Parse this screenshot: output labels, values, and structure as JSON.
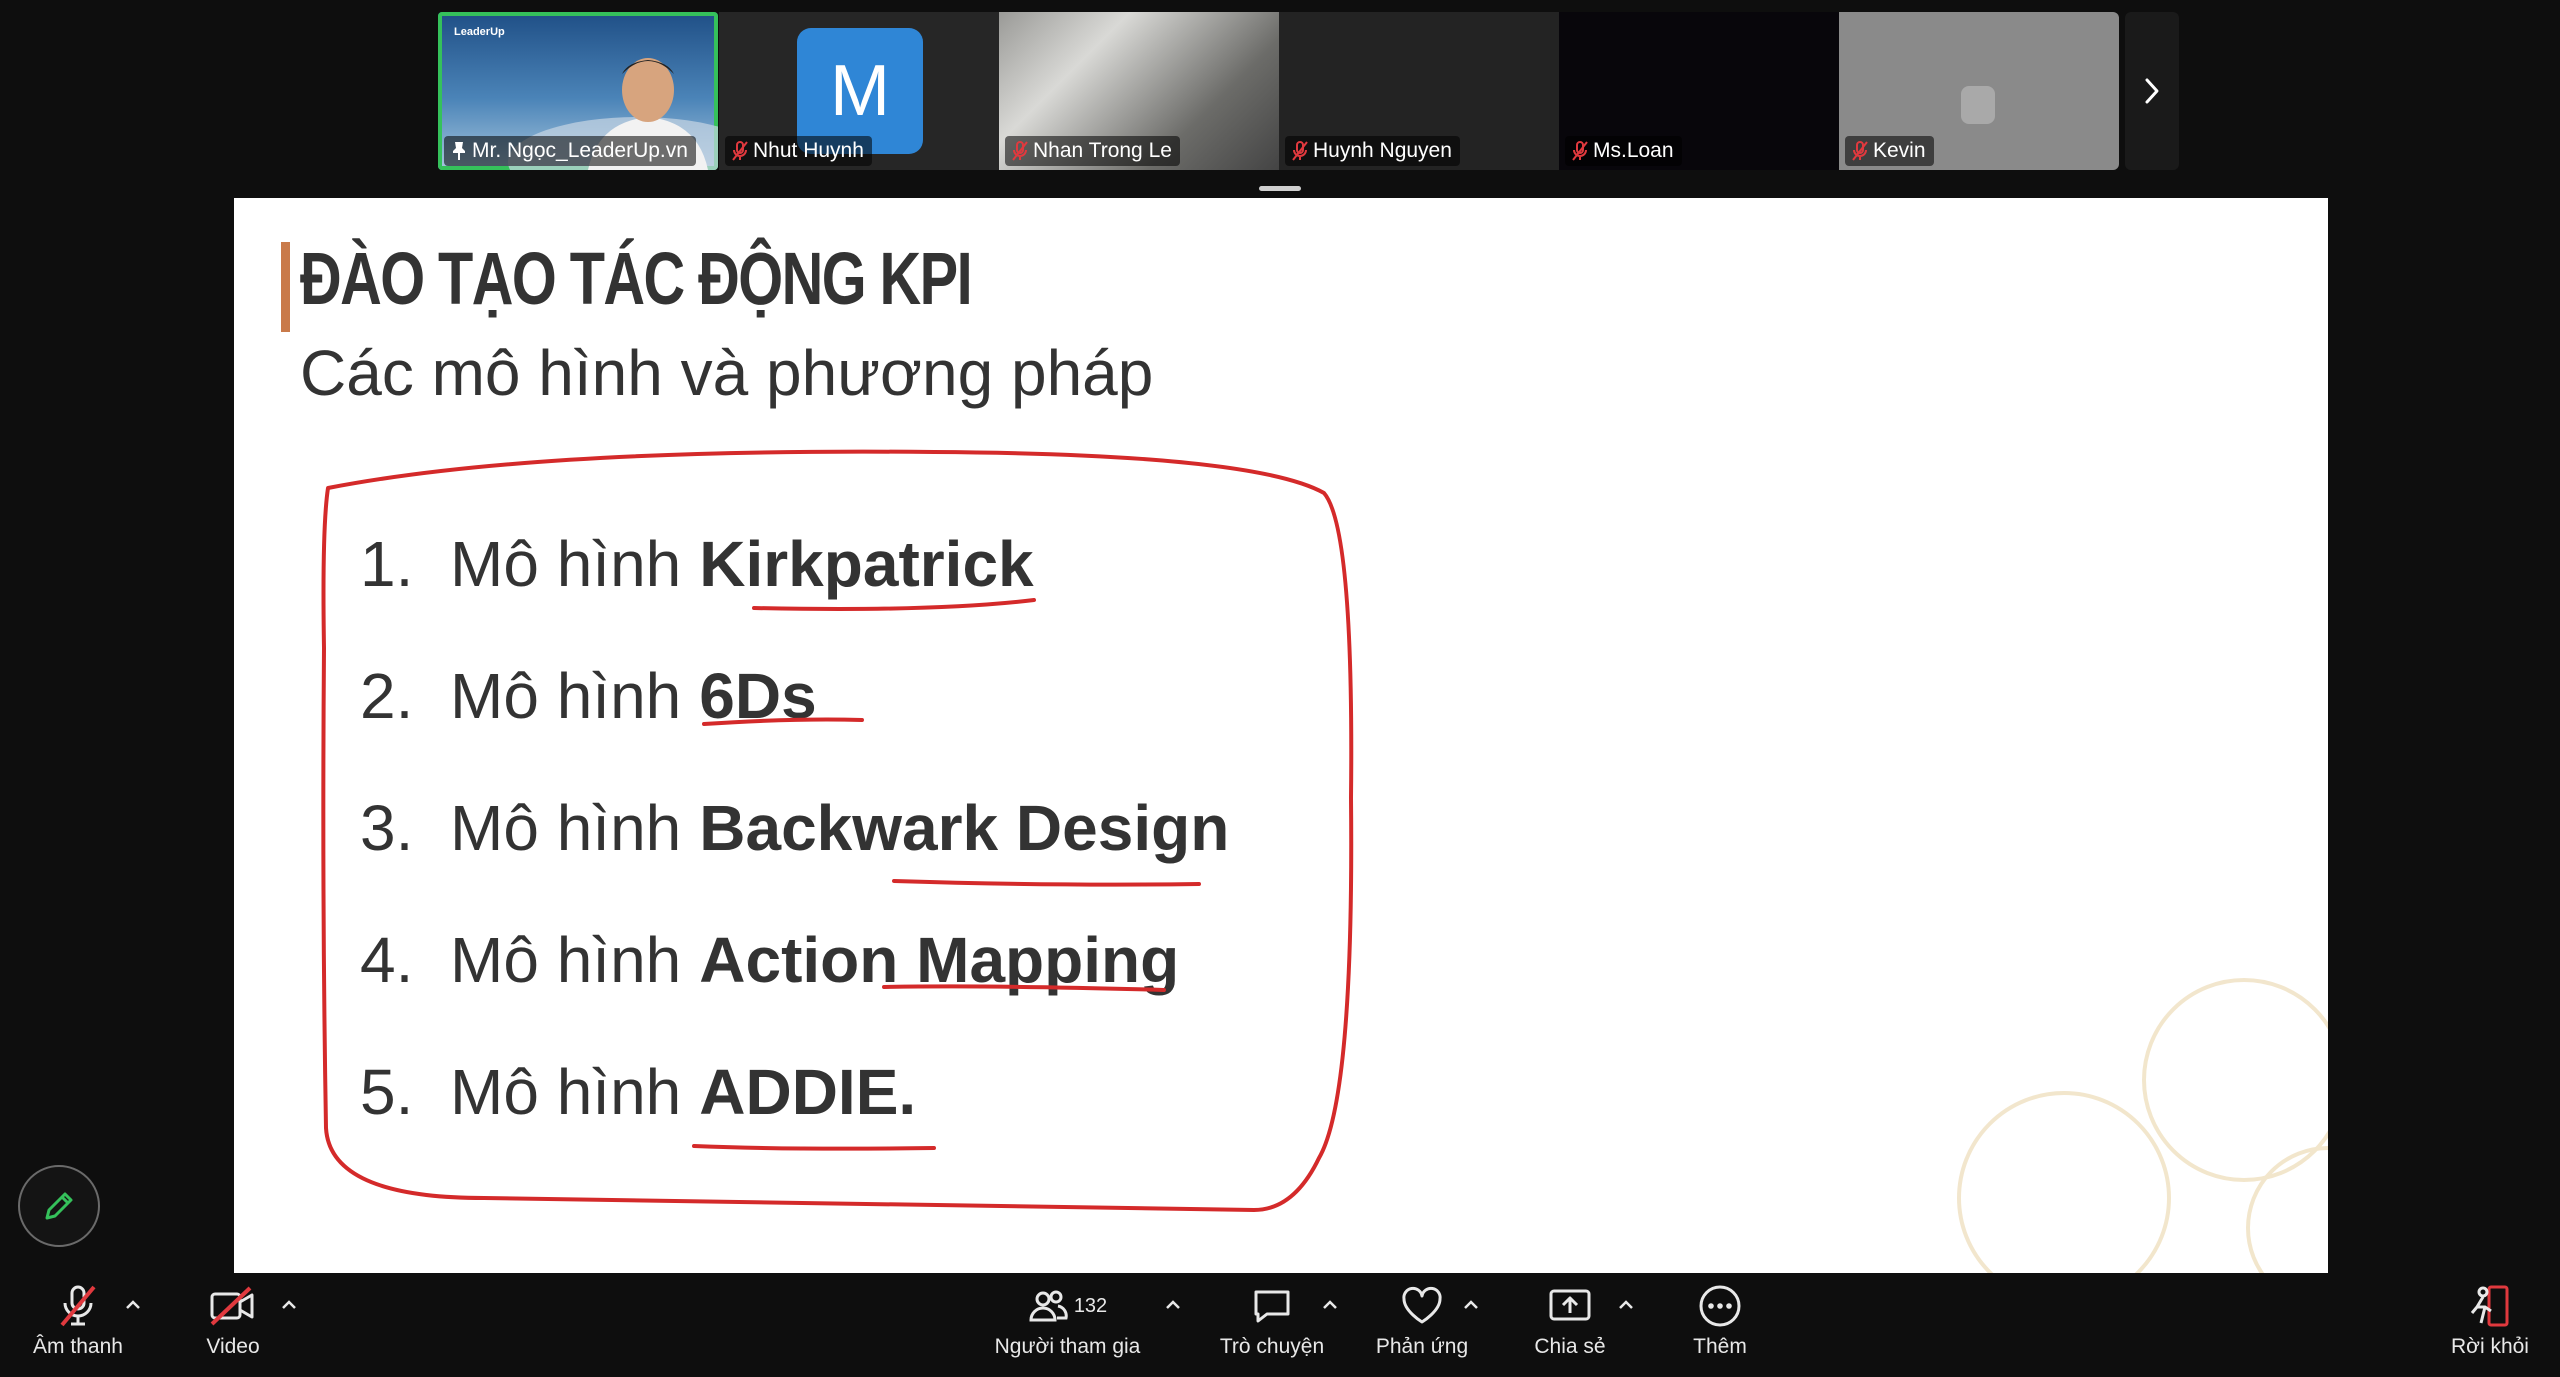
{
  "participants": [
    {
      "name": "Mr. Ngọc_LeaderUp.vn",
      "status": "pinned",
      "video": true,
      "logo_text": "LeaderUp"
    },
    {
      "name": "Nhut Huynh",
      "status": "muted",
      "avatar_letter": "M"
    },
    {
      "name": "Nhan Trong Le",
      "status": "muted"
    },
    {
      "name": "Huynh Nguyen",
      "status": "muted"
    },
    {
      "name": "Ms.Loan",
      "status": "muted"
    },
    {
      "name": "Kevin",
      "status": "muted"
    }
  ],
  "slide": {
    "title": "ĐÀO TẠO TÁC ĐỘNG KPI",
    "subtitle": "Các mô hình và phương pháp",
    "items": [
      {
        "num": "1.",
        "prefix": "Mô hình",
        "bold": "Kirkpatrick"
      },
      {
        "num": "2.",
        "prefix": "Mô hình",
        "bold": "6Ds"
      },
      {
        "num": "3.",
        "prefix": "Mô hình",
        "bold": "Backwark Design"
      },
      {
        "num": "4.",
        "prefix": "Mô hình",
        "bold": "Action Mapping"
      },
      {
        "num": "5.",
        "prefix": "Mô hình",
        "bold": "ADDIE."
      }
    ],
    "accent_color": "#c97a4a",
    "ink_color": "#d42a2a"
  },
  "toolbar": {
    "audio_label": "Âm thanh",
    "video_label": "Video",
    "participants_label": "Người tham gia",
    "participants_count": "132",
    "chat_label": "Trò chuyện",
    "reactions_label": "Phản ứng",
    "share_label": "Chia sẻ",
    "more_label": "Thêm",
    "leave_label": "Rời khỏi"
  },
  "colors": {
    "muted_red": "#e0393e",
    "active_green": "#35c15b",
    "avatar_blue": "#2f86d6"
  }
}
